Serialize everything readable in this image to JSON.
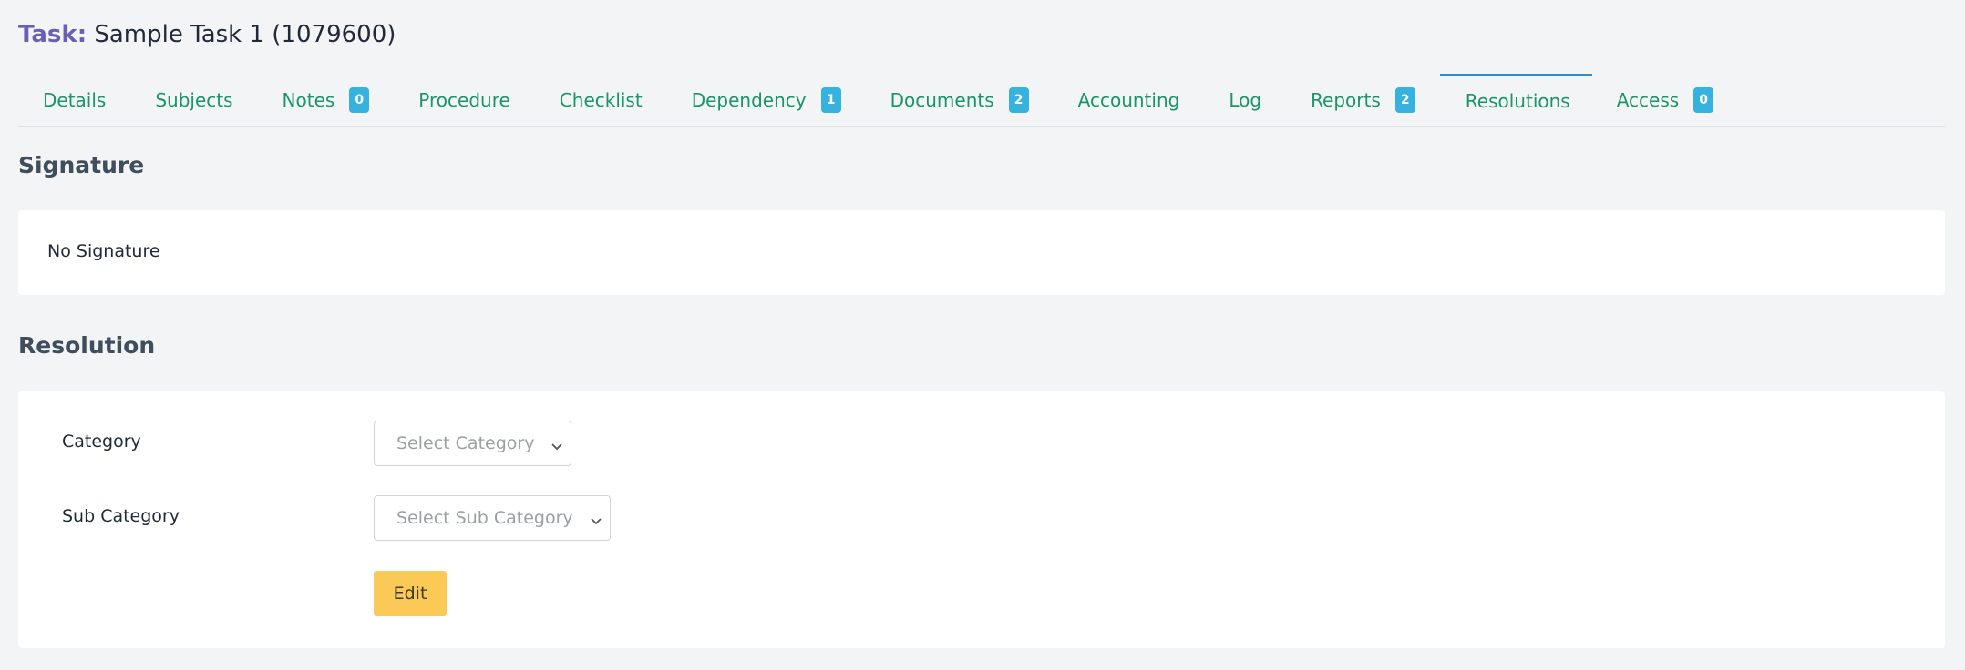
{
  "header": {
    "task_label": "Task:",
    "task_name": "Sample Task 1 (1079600)"
  },
  "tabs": [
    {
      "label": "Details",
      "badge": null
    },
    {
      "label": "Subjects",
      "badge": null
    },
    {
      "label": "Notes",
      "badge": "0"
    },
    {
      "label": "Procedure",
      "badge": null
    },
    {
      "label": "Checklist",
      "badge": null
    },
    {
      "label": "Dependency",
      "badge": "1"
    },
    {
      "label": "Documents",
      "badge": "2"
    },
    {
      "label": "Accounting",
      "badge": null
    },
    {
      "label": "Log",
      "badge": null
    },
    {
      "label": "Reports",
      "badge": "2"
    },
    {
      "label": "Resolutions",
      "badge": null
    },
    {
      "label": "Access",
      "badge": "0"
    }
  ],
  "active_tab": "Resolutions",
  "signature": {
    "heading": "Signature",
    "text": "No Signature"
  },
  "resolution": {
    "heading": "Resolution",
    "category_label": "Category",
    "category_value": "Select Category",
    "subcategory_label": "Sub Category",
    "subcategory_value": "Select Sub Category",
    "edit_label": "Edit"
  },
  "colors": {
    "task_label": "#6b5fb5",
    "tab_text": "#1a9566",
    "badge": "#35b2dd",
    "active_tab_border": "#2b8ed0",
    "edit_button": "#fbc955",
    "heading": "#3f4d5c",
    "background": "#f3f4f6"
  },
  "icons": {
    "select_chevron": "chevron-down-icon"
  }
}
